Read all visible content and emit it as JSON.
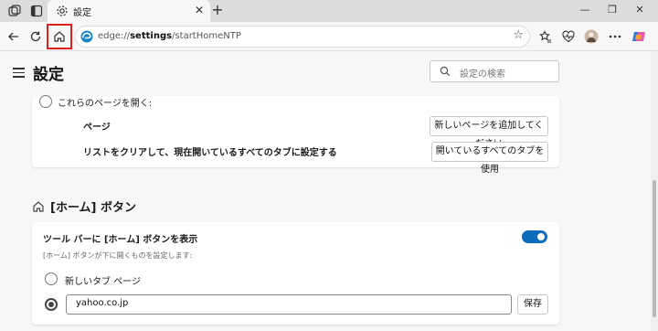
{
  "browser": {
    "tab": {
      "title": "設定",
      "close": "✕"
    },
    "new_tab": "+",
    "window_controls": {
      "minimize": "—",
      "maximize": "❐",
      "close": "✕"
    },
    "address": {
      "prefix": "edge://",
      "bold": "settings",
      "suffix": "/startHomeNTP"
    }
  },
  "settings": {
    "title": "設定",
    "search": {
      "placeholder": "設定の検索"
    },
    "startup_card": {
      "radio_label": "これらのページを開く:",
      "pages_label": "ページ",
      "add_page_button": "新しいページを追加してください",
      "clear_label": "リストをクリアして、現在開いているすべてのタブに設定する",
      "use_open_tabs_button": "開いているすべてのタブを使用"
    },
    "home_section": {
      "title": "[ホーム] ボタン",
      "toggle_label": "ツール バーに [ホーム] ボタンを表示",
      "toggle_desc": "[ホーム] ボタンが下に開くものを設定します:",
      "toggle_on": true,
      "option_newtab": "新しいタブ ページ",
      "url_value": "yahoo.co.jp",
      "save_button": "保存"
    }
  },
  "colors": {
    "accent": "#0f6cbd",
    "highlight": "#e0211b"
  }
}
